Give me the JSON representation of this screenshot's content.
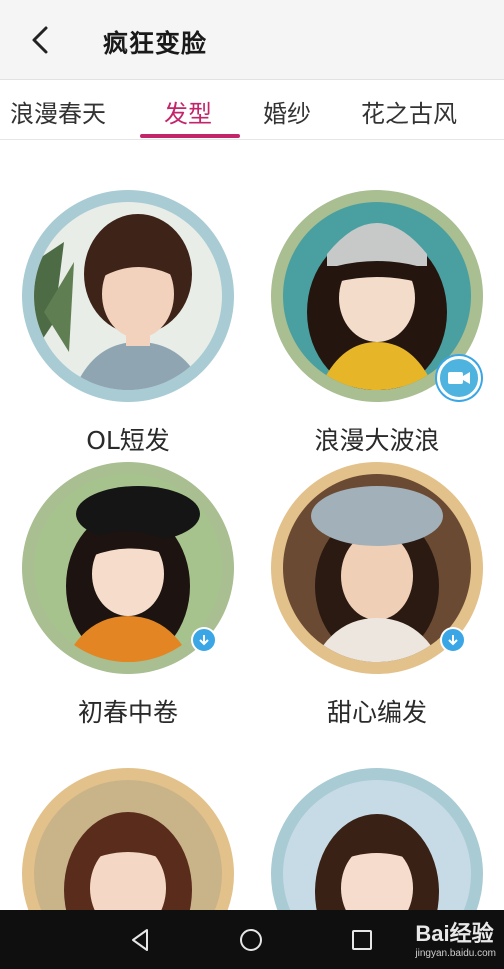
{
  "header": {
    "title": "疯狂变脸",
    "back_icon": "chevron-left-icon"
  },
  "tabs": [
    {
      "label": "浪漫春天",
      "active": false
    },
    {
      "label": "发型",
      "active": true
    },
    {
      "label": "婚纱",
      "active": false
    },
    {
      "label": "花之古风",
      "active": false
    }
  ],
  "accent_color": "#c3256a",
  "styles": [
    {
      "label": "OL短发",
      "ring_color": "#a9cbd4",
      "badge": "none"
    },
    {
      "label": "浪漫大波浪",
      "ring_color": "#a9be91",
      "badge": "camera"
    },
    {
      "label": "初春中卷",
      "ring_color": "#a9be91",
      "badge": "download"
    },
    {
      "label": "甜心编发",
      "ring_color": "#e3c18b",
      "badge": "download"
    },
    {
      "label": "",
      "ring_color": "#e3c18b",
      "badge": "none"
    },
    {
      "label": "",
      "ring_color": "#a9cbd4",
      "badge": "none"
    }
  ],
  "navbar": {
    "back": "triangle-back-icon",
    "home": "circle-home-icon",
    "recent": "square-recent-icon"
  },
  "watermark": {
    "brand": "Bai经验",
    "url": "jingyan.baidu.com"
  }
}
